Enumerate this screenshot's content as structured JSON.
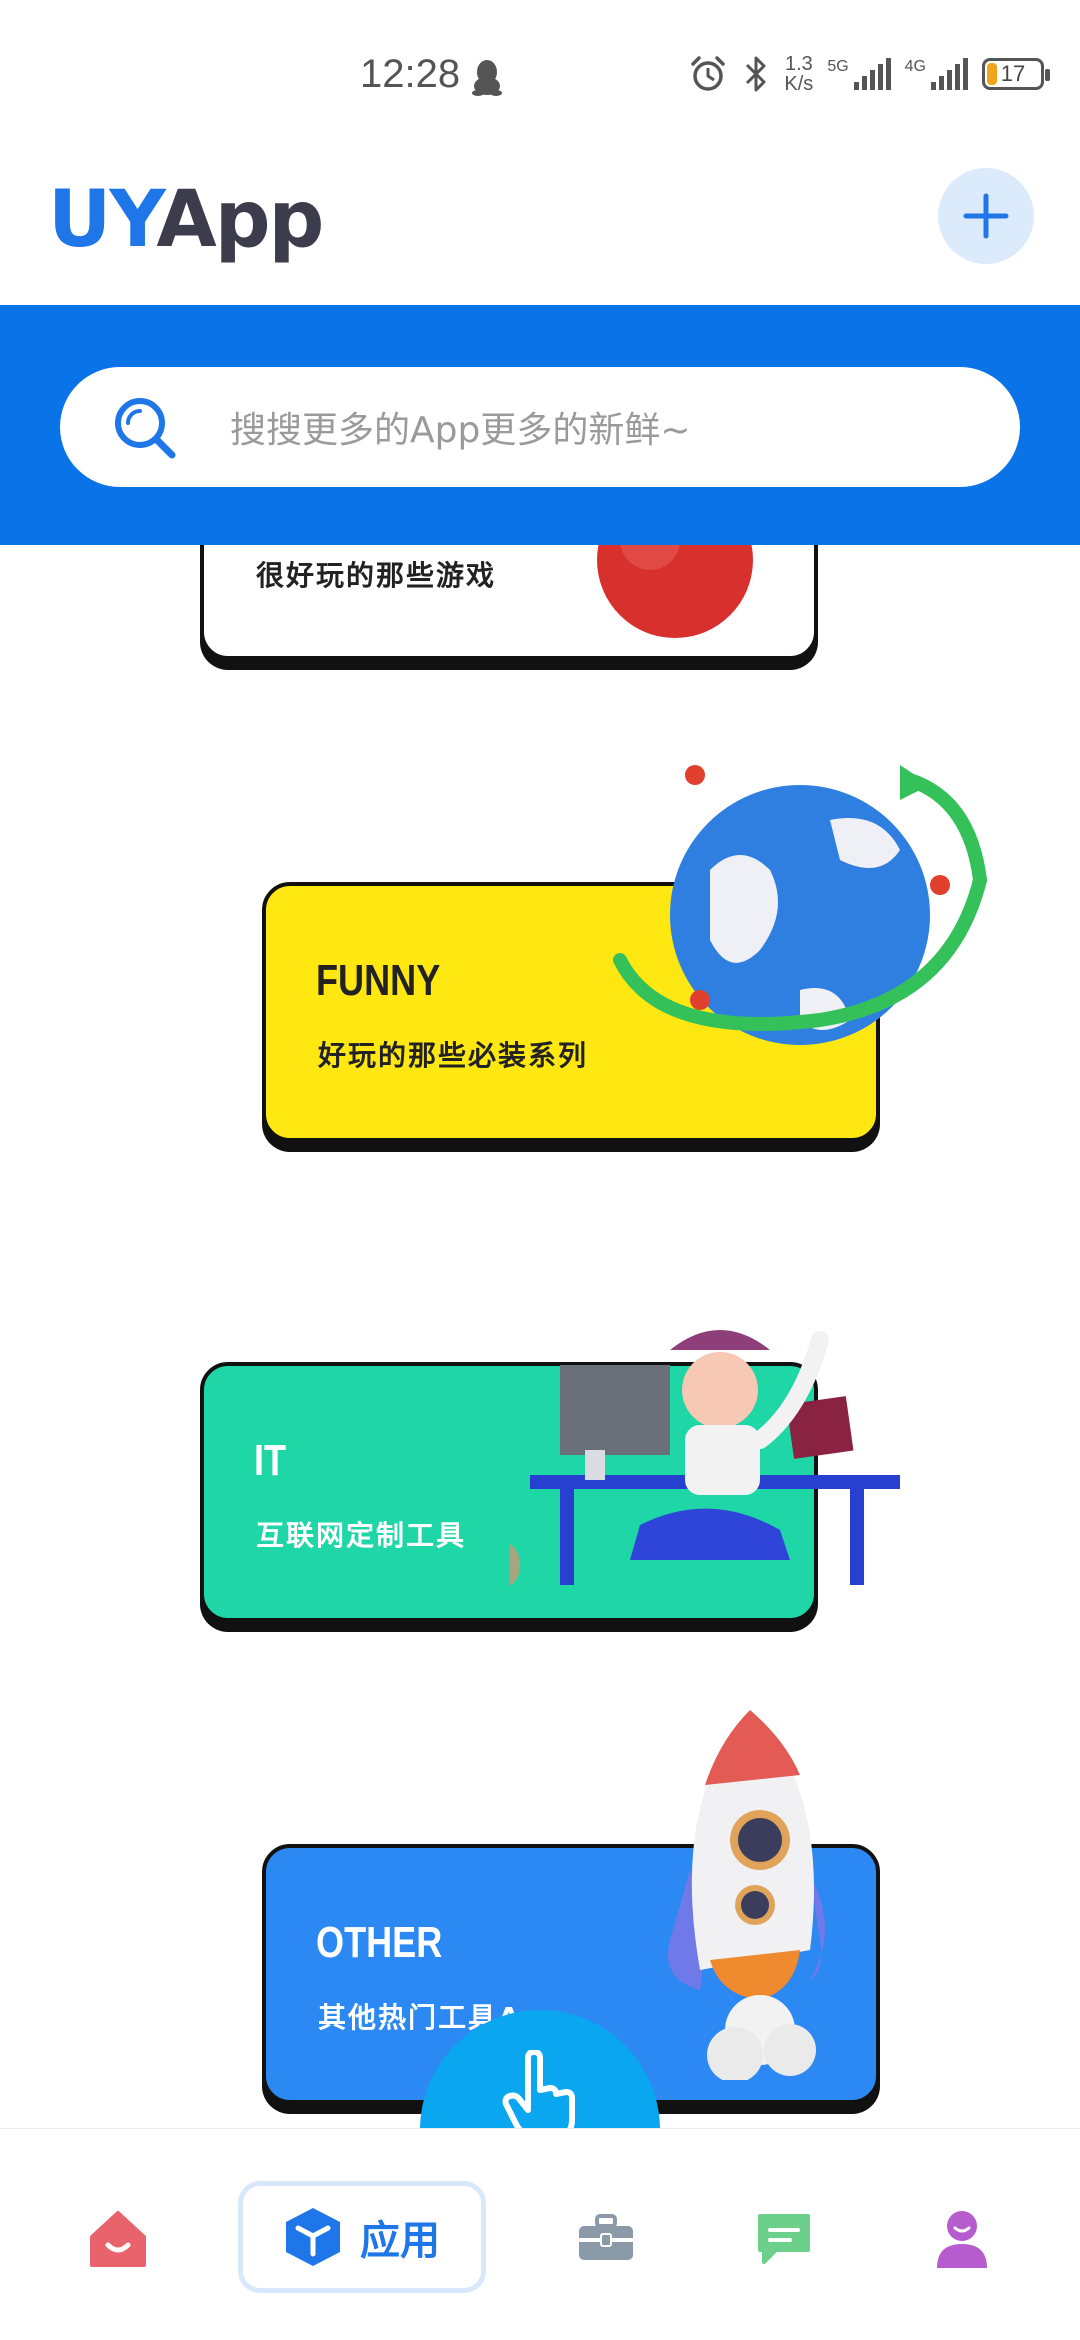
{
  "status_bar": {
    "time": "12:28",
    "net_speed_value": "1.3",
    "net_speed_unit": "K/s",
    "signal1_label": "5G",
    "signal2_label": "4G",
    "battery_level": "17",
    "battery_percent": 0.17,
    "icons": [
      "qq-icon",
      "alarm-icon",
      "bluetooth-icon",
      "signal-icon",
      "battery-icon"
    ]
  },
  "header": {
    "logo_part1": "UY",
    "logo_part2": "App",
    "add_icon": "plus-icon"
  },
  "search": {
    "placeholder": "搜搜更多的App更多的新鲜~",
    "icon": "search-icon"
  },
  "categories": [
    {
      "title": "",
      "subtitle": "很好玩的那些游戏",
      "color": "#ffffff"
    },
    {
      "title": "FUNNY",
      "subtitle": "好玩的那些必装系列",
      "color": "#ffe812"
    },
    {
      "title": "IT",
      "subtitle": "互联网定制工具",
      "color": "#1ed6a6"
    },
    {
      "title": "OTHER",
      "subtitle": "其他热门工具App",
      "color": "#2c88f3"
    }
  ],
  "fab": {
    "icon": "pointer-hand-icon",
    "color": "#0aa6f0"
  },
  "bottom_nav": {
    "items": [
      {
        "icon": "home-icon",
        "color": "#e8636b"
      },
      {
        "icon": "cube-icon",
        "label": "应用",
        "color": "#1f76e8",
        "active": true
      },
      {
        "icon": "toolbox-icon",
        "color": "#8a9aa8"
      },
      {
        "icon": "message-icon",
        "color": "#6ccf8a"
      },
      {
        "icon": "user-icon",
        "color": "#b65ccf"
      }
    ]
  },
  "colors": {
    "brand_blue": "#0a73e8",
    "text_dark": "#222222"
  }
}
